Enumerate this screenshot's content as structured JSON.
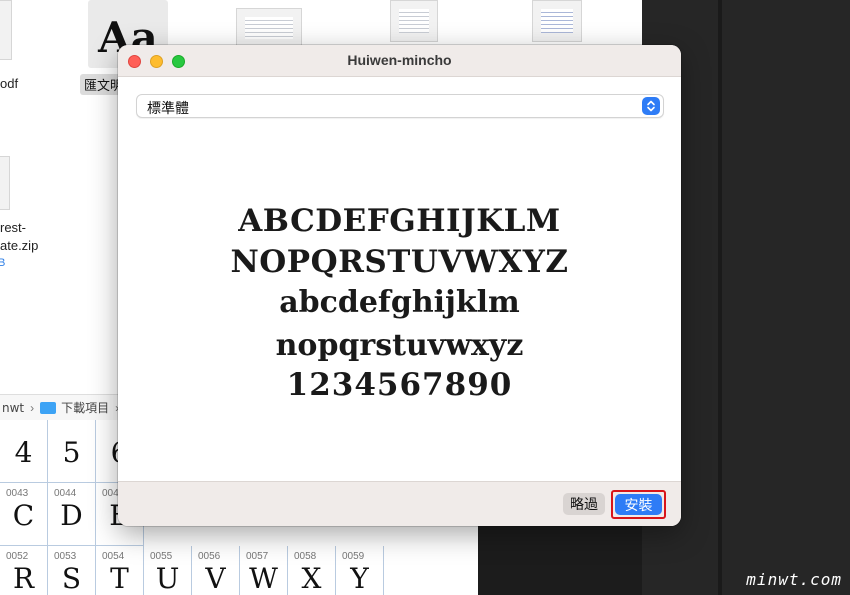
{
  "window": {
    "title": "Huiwen-mincho"
  },
  "style_select": {
    "value": "標準體"
  },
  "preview": {
    "uppercase_line1": "ABCDEFGHIJKLM",
    "uppercase_line2": "NOPQRSTUVWXYZ",
    "lowercase_line1": "abcdefghijklm",
    "lowercase_line2": "nopqrstuvwxyz",
    "digits": "1234567890"
  },
  "footer": {
    "skip_label": "略過",
    "install_label": "安裝"
  },
  "finder": {
    "files": [
      {
        "name": "odf"
      },
      {
        "name": "匯文明",
        "icon_text": "Aa"
      },
      {
        "name": "rest-"
      },
      {
        "name": "ate.zip",
        "size": "B"
      }
    ],
    "path": [
      "nwt",
      "下載項目"
    ]
  },
  "glyph_grid": {
    "cells": [
      {
        "code": "",
        "glyph": "4"
      },
      {
        "code": "",
        "glyph": "5"
      },
      {
        "code": "",
        "glyph": "6"
      },
      {
        "code": "0043",
        "glyph": "C"
      },
      {
        "code": "0044",
        "glyph": "D"
      },
      {
        "code": "0045",
        "glyph": "E"
      },
      {
        "code": "0052",
        "glyph": "R"
      },
      {
        "code": "0053",
        "glyph": "S"
      },
      {
        "code": "0054",
        "glyph": "T"
      },
      {
        "code": "0055",
        "glyph": "U"
      },
      {
        "code": "0056",
        "glyph": "V"
      },
      {
        "code": "0057",
        "glyph": "W"
      },
      {
        "code": "0058",
        "glyph": "X"
      },
      {
        "code": "0059",
        "glyph": "Y"
      }
    ]
  },
  "watermark": "minwt.com",
  "colors": {
    "accent": "#2e7cf6",
    "highlight": "#d8151a",
    "dialog_chrome": "#f0ebe9"
  }
}
